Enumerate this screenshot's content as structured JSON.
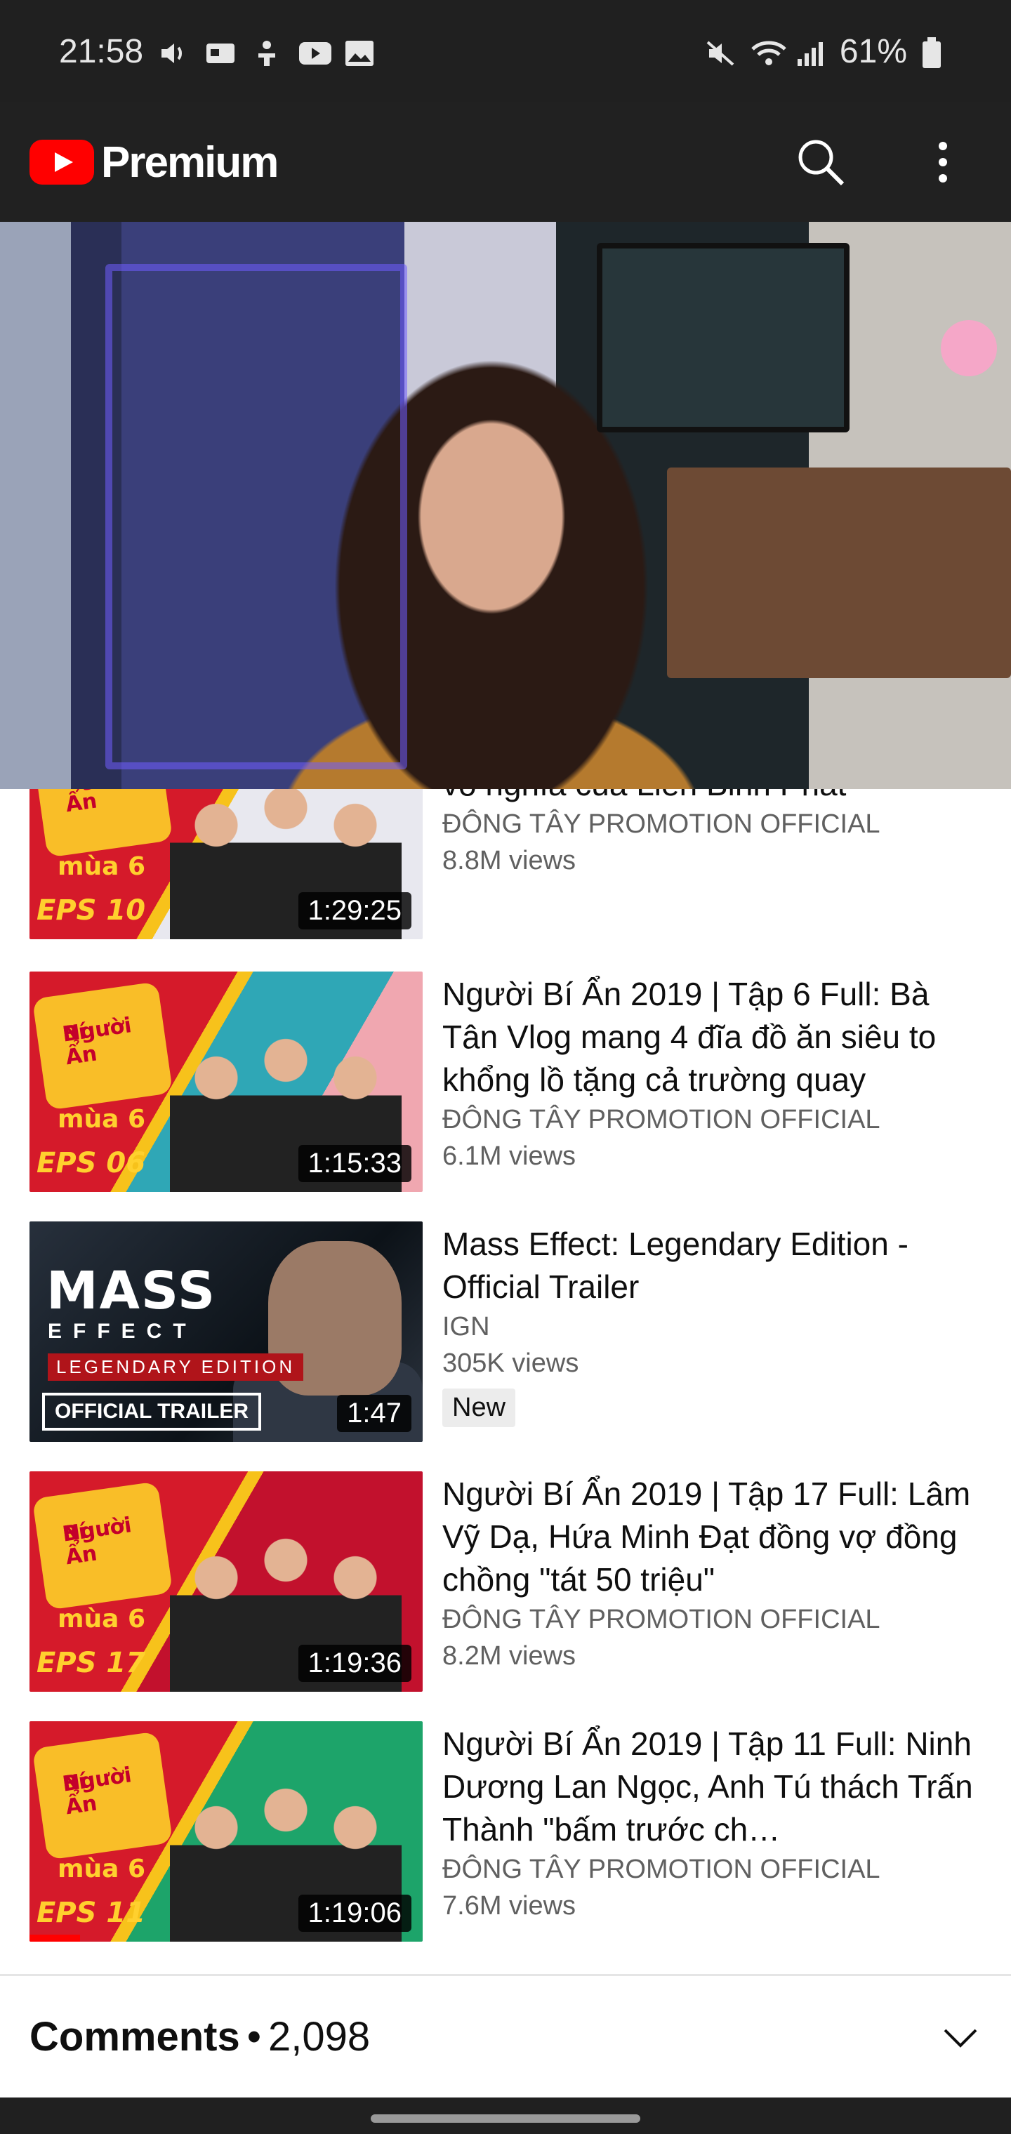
{
  "status_bar": {
    "time": "21:58",
    "battery": "61%"
  },
  "app_bar": {
    "logo_text": "Premium"
  },
  "videos": [
    {
      "title": "Trấn không do nói những phát ngôn vô nghĩa của Liên Bỉnh Phát",
      "channel": "ĐÔNG TÂY PROMOTION OFFICIAL",
      "views": "8.8M views",
      "duration": "1:29:25",
      "badge": "EPS 10"
    },
    {
      "title": "Người Bí Ẩn 2019 | Tập 6 Full: Bà Tân Vlog mang 4 đĩa đồ ăn siêu to khổng lồ tặng cả trường quay",
      "channel": "ĐÔNG TÂY PROMOTION OFFICIAL",
      "views": "6.1M views",
      "duration": "1:15:33",
      "badge": "EPS 06"
    },
    {
      "title": "Mass Effect: Legendary Edition - Official Trailer",
      "channel": "IGN",
      "views": "305K views",
      "duration": "1:47",
      "tag": "New",
      "thumb_title": "MASS",
      "thumb_sub": "EFFECT",
      "thumb_legend": "LEGENDARY EDITION",
      "thumb_label": "OFFICIAL TRAILER"
    },
    {
      "title": "Người Bí Ẩn 2019 | Tập 17 Full: Lâm Vỹ Dạ, Hứa Minh Đạt đồng vợ đồng chồng \"tát 50 triệu\"",
      "channel": "ĐÔNG TÂY PROMOTION OFFICIAL",
      "views": "8.2M views",
      "duration": "1:19:36",
      "badge": "EPS 17"
    },
    {
      "title": "Người Bí Ẩn 2019 | Tập 11 Full: Ninh Dương Lan Ngọc, Anh Tú thách Trấn Thành \"bấm trước ch…",
      "channel": "ĐÔNG TÂY PROMOTION OFFICIAL",
      "views": "7.6M views",
      "duration": "1:19:06",
      "badge": "EPS 11"
    }
  ],
  "thumb_brand": {
    "line1": "Người",
    "line2": "Bí Ẩn",
    "season": "mùa 6"
  },
  "comments": {
    "label": "Comments",
    "separator": "•",
    "count": "2,098"
  }
}
